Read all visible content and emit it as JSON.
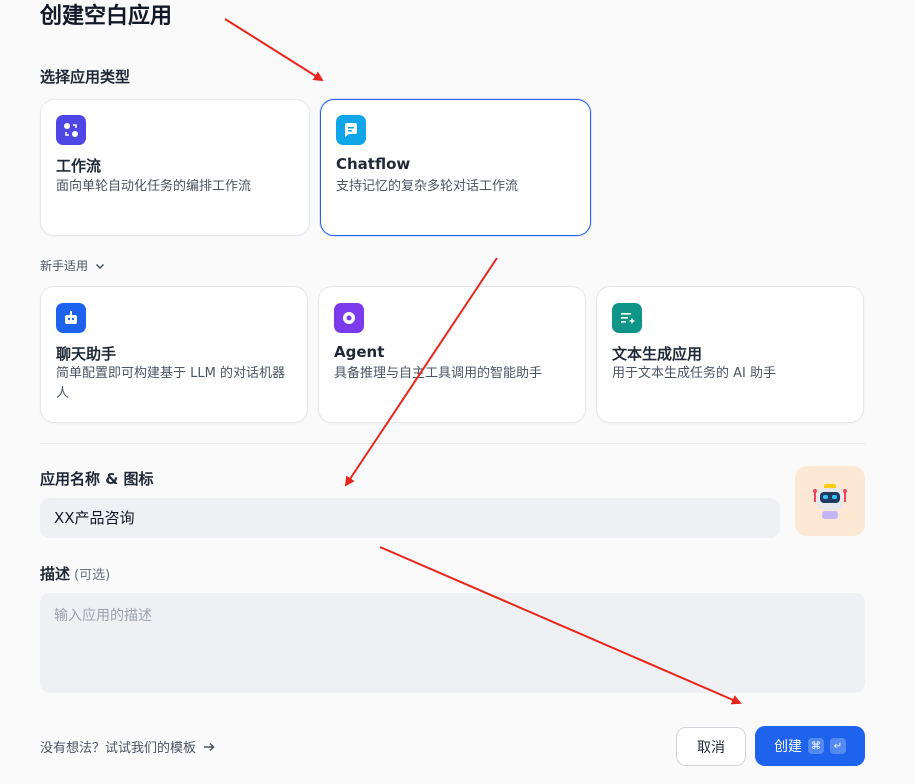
{
  "page_title": "创建空白应用",
  "app_type_label": "选择应用类型",
  "primary_types": [
    {
      "title": "工作流",
      "desc": "面向单轮自动化任务的编排工作流",
      "icon": "workflow-icon",
      "color": "#4f46e5",
      "selected": false
    },
    {
      "title": "Chatflow",
      "desc": "支持记忆的复杂多轮对话工作流",
      "icon": "chatflow-icon",
      "color": "#0ea5e9",
      "selected": true
    }
  ],
  "beginner_toggle": "新手适用",
  "beginner_types": [
    {
      "title": "聊天助手",
      "desc": "简单配置即可构建基于 LLM 的对话机器人",
      "icon": "chat-assistant-icon",
      "color": "#1d63ed"
    },
    {
      "title": "Agent",
      "desc": "具备推理与自主工具调用的智能助手",
      "icon": "agent-icon",
      "color": "#7c3aed"
    },
    {
      "title": "文本生成应用",
      "desc": "用于文本生成任务的 AI 助手",
      "icon": "text-generator-icon",
      "color": "#0f9488"
    }
  ],
  "name_icon_label": "应用名称 & 图标",
  "name_value": "XX产品咨询",
  "desc_label": "描述",
  "desc_optional": "(可选)",
  "desc_placeholder": "输入应用的描述",
  "template_link": "没有想法？试试我们的模板",
  "cancel_label": "取消",
  "create_label": "创建",
  "shortcut_keys": [
    "⌘",
    "↵"
  ],
  "accent_color": "#1d63ed",
  "annotation_color": "#e8261b"
}
